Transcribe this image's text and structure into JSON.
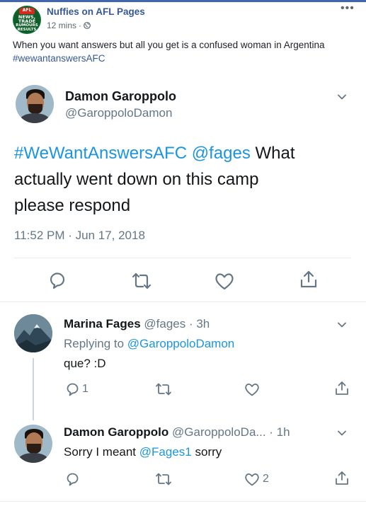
{
  "post": {
    "page_name": "Nuffies on AFL Pages",
    "time": "12 mins",
    "text": "When you want answers but all you get is a confused woman in Argentina",
    "hashtag": "#wewantanswersAFC",
    "avatar_lines": [
      "AFL",
      "NEWS,",
      "TRADE",
      "RUMOURS",
      "RESULTS"
    ]
  },
  "main_tweet": {
    "name": "Damon Garoppolo",
    "handle": "@GaroppoloDamon",
    "text_link1": "#WeWantAnswersAFC",
    "text_link2": "@fages",
    "text_rest1": "What",
    "text_line2": "actually went down on this camp",
    "text_line3": "please respond",
    "timestamp": "11:52 PM · Jun 17, 2018"
  },
  "reply1": {
    "name": "Marina Fages",
    "handle_time": "@fages · 3h",
    "replying_prefix": "Replying to",
    "replying_to": "@GaroppoloDamon",
    "text": "que? :D",
    "reply_count": "1"
  },
  "reply2": {
    "name": "Damon Garoppolo",
    "handle": "@GaroppoloDa...",
    "time": "· 1h",
    "text_prefix": "Sorry I meant",
    "text_mention": "@Fages1",
    "text_suffix": "sorry",
    "like_count": "2"
  },
  "colors": {
    "facebook_blue": "#365899",
    "twitter_link": "#1b95e0",
    "muted": "#657786"
  }
}
